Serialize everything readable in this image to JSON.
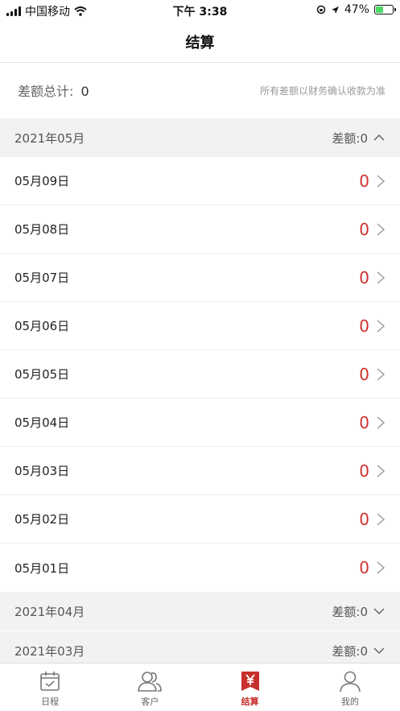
{
  "status_bar": {
    "carrier": "中国移动",
    "time": "下午 3:38",
    "battery": "47%",
    "battery_level": 0.47
  },
  "nav": {
    "title": "结算"
  },
  "summary": {
    "label": "差额总计:",
    "value": "0",
    "note": "所有差额以财务确认收款为准"
  },
  "months": [
    {
      "label": "2021年05月",
      "diff": "差额:0",
      "expanded": true
    },
    {
      "label": "2021年04月",
      "diff": "差额:0",
      "expanded": false
    },
    {
      "label": "2021年03月",
      "diff": "差额:0",
      "expanded": false
    }
  ],
  "days": [
    {
      "date": "05月09日",
      "value": "0"
    },
    {
      "date": "05月08日",
      "value": "0"
    },
    {
      "date": "05月07日",
      "value": "0"
    },
    {
      "date": "05月06日",
      "value": "0"
    },
    {
      "date": "05月05日",
      "value": "0"
    },
    {
      "date": "05月04日",
      "value": "0"
    },
    {
      "date": "05月03日",
      "value": "0"
    },
    {
      "date": "05月02日",
      "value": "0"
    },
    {
      "date": "05月01日",
      "value": "0"
    }
  ],
  "tabs": [
    {
      "label": "日程",
      "icon": "calendar-icon",
      "active": false
    },
    {
      "label": "客户",
      "icon": "customers-icon",
      "active": false
    },
    {
      "label": "结算",
      "icon": "yen-icon",
      "active": true
    },
    {
      "label": "我的",
      "icon": "person-icon",
      "active": false
    }
  ],
  "colors": {
    "accent": "#c8302c",
    "amount": "#d0312d",
    "header_bg": "#f2f2f2"
  }
}
